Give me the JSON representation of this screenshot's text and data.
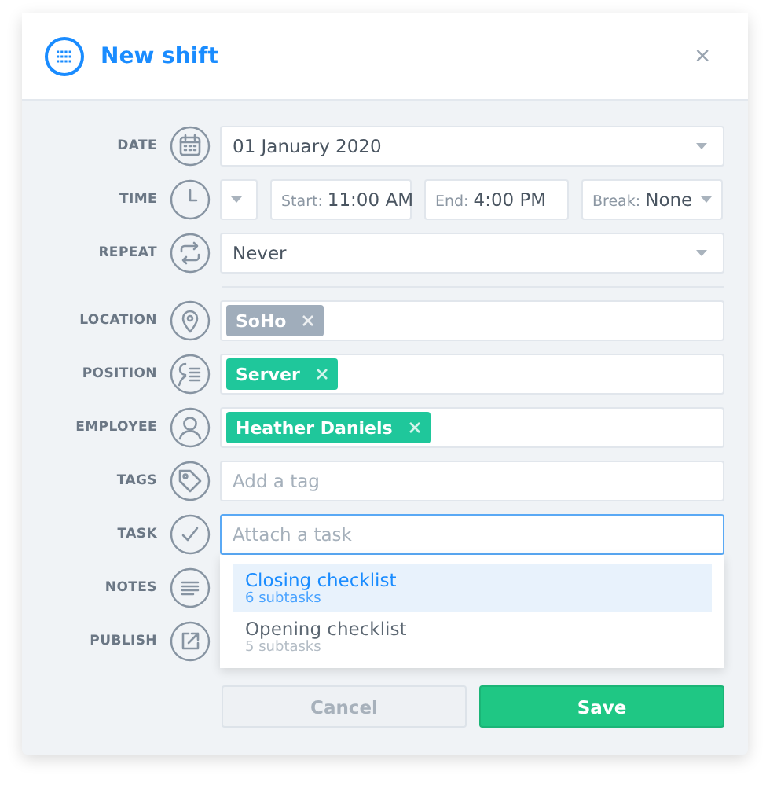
{
  "dialog": {
    "title": "New shift",
    "close": "×"
  },
  "sections": [
    [
      {
        "label": "DATE",
        "kind": "select",
        "value": "01 January 2020"
      },
      {
        "label": "TIME",
        "kind": "time",
        "parts": [
          {
            "prefix": "Start:",
            "value": "11:00 AM"
          },
          {
            "prefix": "End:",
            "value": "4:00 PM"
          }
        ],
        "break": {
          "prefix": "Break:",
          "value": "None"
        }
      },
      {
        "label": "REPEAT",
        "kind": "select",
        "value": "Never"
      }
    ],
    [
      {
        "label": "LOCATION",
        "kind": "tags",
        "tags": [
          {
            "text": "SoHo",
            "color": "#a0adbb"
          }
        ]
      },
      {
        "label": "POSITION",
        "kind": "tags",
        "tags": [
          {
            "text": "Server",
            "color": "#1fc79b"
          }
        ]
      },
      {
        "label": "EMPLOYEE",
        "kind": "tags",
        "tags": [
          {
            "text": "Heather Daniels",
            "color": "#1fc79b"
          }
        ]
      },
      {
        "label": "TAGS",
        "kind": "input",
        "placeholder": "Add a tag",
        "focused": false
      },
      {
        "label": "TASK",
        "kind": "input",
        "placeholder": "Attach a task",
        "focused": true,
        "suggestions": [
          {
            "title": "Closing checklist",
            "subtitle": "6 subtasks",
            "selected": true
          },
          {
            "title": "Opening checklist",
            "subtitle": "5 subtasks",
            "selected": false
          }
        ]
      },
      {
        "label": "NOTES",
        "kind": "covered"
      },
      {
        "label": "PUBLISH",
        "kind": "covered"
      }
    ]
  ],
  "buttons": [
    {
      "label": "Cancel",
      "kind": "secondary"
    },
    {
      "label": "Save",
      "kind": "primary"
    }
  ]
}
